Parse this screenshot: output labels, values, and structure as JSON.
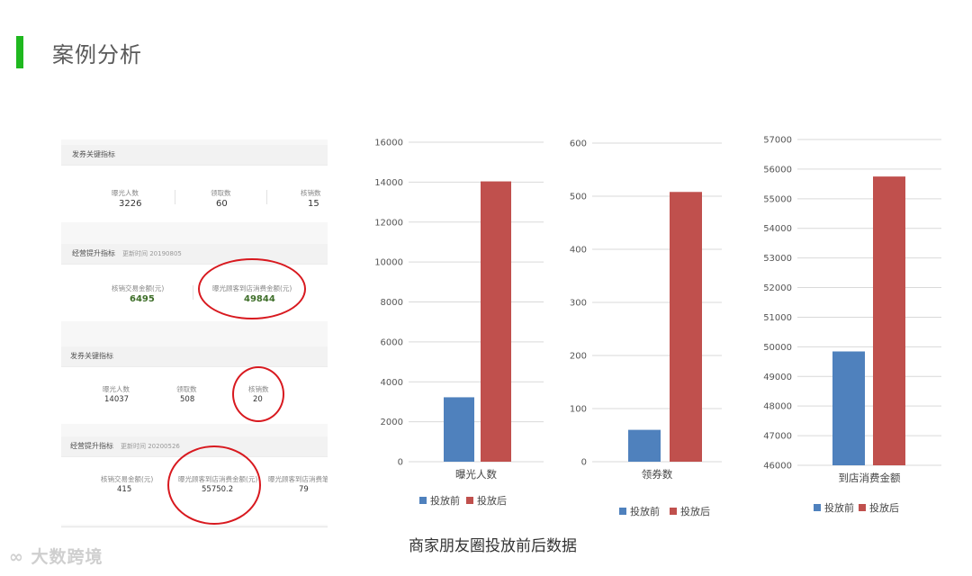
{
  "page": {
    "title": "案例分析",
    "caption": "商家朋友圈投放前后数据",
    "watermark": "大数跨境"
  },
  "screenshot": {
    "card1": {
      "header": "发券关键指标",
      "metrics": [
        {
          "label": "曝光人数",
          "value": "3226"
        },
        {
          "label": "领取数",
          "value": "60"
        },
        {
          "label": "核销数",
          "value": "15"
        }
      ]
    },
    "card2": {
      "header": "经营提升指标",
      "updated": "更新时间 20190805",
      "metrics": [
        {
          "label": "核销交易金额(元)",
          "value": "6495"
        },
        {
          "label": "曝光顾客到店消费金额(元)",
          "value": "49844"
        }
      ]
    },
    "card3": {
      "header": "发券关键指标",
      "metrics": [
        {
          "label": "曝光人数",
          "value": "14037"
        },
        {
          "label": "领取数",
          "value": "508"
        },
        {
          "label": "核销数",
          "value": "20"
        }
      ]
    },
    "card4": {
      "header": "经营提升指标",
      "updated": "更新时间 20200526",
      "metrics": [
        {
          "label": "核销交易金额(元)",
          "value": "415"
        },
        {
          "label": "曝光顾客到店消费金额(元)",
          "value": "55750.2"
        },
        {
          "label": "曝光顾客到店消费笔",
          "value": "79"
        }
      ]
    },
    "ring_color": "#d8191f"
  },
  "colors": {
    "before": "#4f81bd",
    "after": "#c0504d",
    "grid": "#d9d9d9"
  },
  "chart_data": [
    {
      "type": "bar",
      "categories": [
        "曝光人数"
      ],
      "series": [
        {
          "name": "投放前",
          "values": [
            3226
          ]
        },
        {
          "name": "投放后",
          "values": [
            14037
          ]
        }
      ],
      "ylim": [
        0,
        16000
      ],
      "yticks": [
        0,
        2000,
        4000,
        6000,
        8000,
        10000,
        12000,
        14000,
        16000
      ],
      "grid": true,
      "legend": "bottom"
    },
    {
      "type": "bar",
      "categories": [
        "领券数"
      ],
      "series": [
        {
          "name": "投放前",
          "values": [
            60
          ]
        },
        {
          "name": "投放后",
          "values": [
            508
          ]
        }
      ],
      "ylim": [
        0,
        600
      ],
      "yticks": [
        0,
        100,
        200,
        300,
        400,
        500,
        600
      ],
      "grid": true,
      "legend": "bottom"
    },
    {
      "type": "bar",
      "categories": [
        "到店消费金额"
      ],
      "series": [
        {
          "name": "投放前",
          "values": [
            49844
          ]
        },
        {
          "name": "投放后",
          "values": [
            55750.2
          ]
        }
      ],
      "ylim": [
        46000,
        57000
      ],
      "yticks": [
        46000,
        47000,
        48000,
        49000,
        50000,
        51000,
        52000,
        53000,
        54000,
        55000,
        56000,
        57000
      ],
      "grid": true,
      "legend": "bottom"
    }
  ]
}
